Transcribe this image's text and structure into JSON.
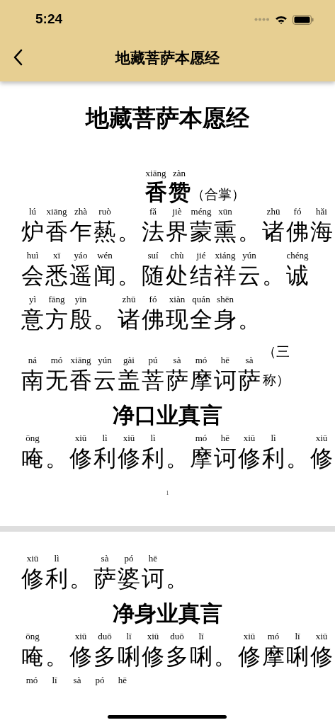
{
  "status_bar": {
    "time": "5:24"
  },
  "nav": {
    "title": "地藏菩萨本愿经"
  },
  "pages": [
    {
      "title": "地藏菩萨本愿经",
      "page_number": "1",
      "blocks": [
        {
          "kind": "heading",
          "tokens": [
            {
              "c": "香",
              "p": "xiāng"
            },
            {
              "c": "赞",
              "p": "zàn"
            }
          ],
          "note": "（合掌）"
        },
        {
          "kind": "verse",
          "tokens": [
            {
              "c": "炉",
              "p": "lú"
            },
            {
              "c": "香",
              "p": "xiāng"
            },
            {
              "c": "乍",
              "p": "zhà"
            },
            {
              "c": "爇",
              "p": "ruò"
            },
            {
              "c": "。"
            },
            {
              "c": "法",
              "p": "fǎ"
            },
            {
              "c": "界",
              "p": "jiè"
            },
            {
              "c": "蒙",
              "p": "méng"
            },
            {
              "c": "熏",
              "p": "xūn"
            },
            {
              "c": "。"
            },
            {
              "c": "诸",
              "p": "zhū"
            },
            {
              "c": "佛",
              "p": "fó"
            },
            {
              "c": "海",
              "p": "hǎi"
            }
          ]
        },
        {
          "kind": "verse",
          "tokens": [
            {
              "c": "会",
              "p": "huì"
            },
            {
              "c": "悉",
              "p": "xī"
            },
            {
              "c": "遥",
              "p": "yáo"
            },
            {
              "c": "闻",
              "p": "wén"
            },
            {
              "c": "。"
            },
            {
              "c": "随",
              "p": "suí"
            },
            {
              "c": "处",
              "p": "chù"
            },
            {
              "c": "结",
              "p": "jié"
            },
            {
              "c": "祥",
              "p": "xiáng"
            },
            {
              "c": "云",
              "p": "yún"
            },
            {
              "c": "。"
            },
            {
              "c": "诚",
              "p": "chéng"
            }
          ]
        },
        {
          "kind": "verse",
          "tokens": [
            {
              "c": "意",
              "p": "yì"
            },
            {
              "c": "方",
              "p": "fāng"
            },
            {
              "c": "殷",
              "p": "yīn"
            },
            {
              "c": "。"
            },
            {
              "c": "诸",
              "p": "zhū"
            },
            {
              "c": "佛",
              "p": "fó"
            },
            {
              "c": "现",
              "p": "xiàn"
            },
            {
              "c": "全",
              "p": "quán"
            },
            {
              "c": "身",
              "p": "shēn"
            },
            {
              "c": "。"
            }
          ]
        },
        {
          "kind": "verse",
          "tokens": [
            {
              "c": "南",
              "p": "ná"
            },
            {
              "c": "无",
              "p": "mó"
            },
            {
              "c": "香",
              "p": "xiāng"
            },
            {
              "c": "云",
              "p": "yún"
            },
            {
              "c": "盖",
              "p": "gài"
            },
            {
              "c": "菩",
              "p": "pú"
            },
            {
              "c": "萨",
              "p": "sà"
            },
            {
              "c": "摩",
              "p": "mó"
            },
            {
              "c": "诃",
              "p": "hē"
            },
            {
              "c": "萨",
              "p": "sà"
            }
          ],
          "note": "（三称）"
        },
        {
          "kind": "heading",
          "tokens": [
            {
              "c": "净"
            },
            {
              "c": "口"
            },
            {
              "c": "业"
            },
            {
              "c": "真"
            },
            {
              "c": "言"
            }
          ]
        },
        {
          "kind": "verse",
          "tokens": [
            {
              "c": "唵",
              "p": "ōng"
            },
            {
              "c": "。"
            },
            {
              "c": "修",
              "p": "xiū"
            },
            {
              "c": "利",
              "p": "lì"
            },
            {
              "c": "修",
              "p": "xiū"
            },
            {
              "c": "利",
              "p": "lì"
            },
            {
              "c": "。"
            },
            {
              "c": "摩",
              "p": "mó"
            },
            {
              "c": "诃",
              "p": "hē"
            },
            {
              "c": "修",
              "p": "xiū"
            },
            {
              "c": "利",
              "p": "lì"
            },
            {
              "c": "。"
            },
            {
              "c": "修",
              "p": "xiū"
            }
          ]
        }
      ]
    },
    {
      "blocks": [
        {
          "kind": "verse",
          "tokens": [
            {
              "c": "修",
              "p": "xiū"
            },
            {
              "c": "利",
              "p": "lì"
            },
            {
              "c": "。"
            },
            {
              "c": "萨",
              "p": "sà"
            },
            {
              "c": "婆",
              "p": "pó"
            },
            {
              "c": "诃",
              "p": "hē"
            },
            {
              "c": "。"
            }
          ]
        },
        {
          "kind": "heading",
          "tokens": [
            {
              "c": "净"
            },
            {
              "c": "身"
            },
            {
              "c": "业"
            },
            {
              "c": "真"
            },
            {
              "c": "言"
            }
          ]
        },
        {
          "kind": "verse",
          "tokens": [
            {
              "c": "唵",
              "p": "ōng"
            },
            {
              "c": "。"
            },
            {
              "c": "修",
              "p": "xiū"
            },
            {
              "c": "多",
              "p": "duō"
            },
            {
              "c": "唎",
              "p": "lī"
            },
            {
              "c": "修",
              "p": "xiū"
            },
            {
              "c": "多",
              "p": "duō"
            },
            {
              "c": "唎",
              "p": "lī"
            },
            {
              "c": "。"
            },
            {
              "c": "修",
              "p": "xiū"
            },
            {
              "c": "摩",
              "p": "mó"
            },
            {
              "c": "唎",
              "p": "lī"
            },
            {
              "c": "修",
              "p": "xiū"
            }
          ]
        },
        {
          "kind": "verse",
          "tokens": [
            {
              "p": "mó"
            },
            {
              "p": "lī"
            },
            {
              "p": "sà"
            },
            {
              "p": "pó"
            },
            {
              "p": "hē"
            }
          ]
        }
      ]
    }
  ]
}
